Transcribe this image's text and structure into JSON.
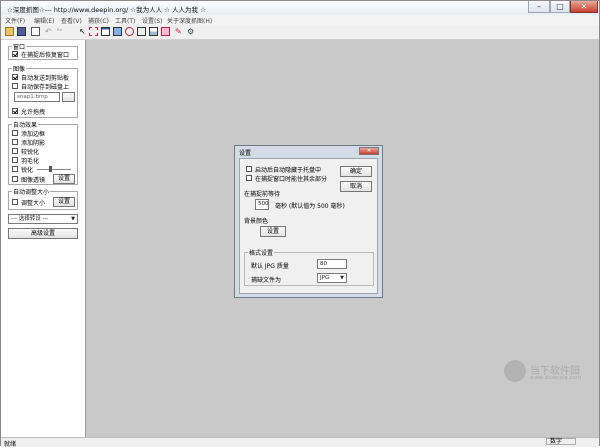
{
  "app": {
    "title": "☆深度抓图☆--- http://www.deepin.org/    ☆我为人人 ☆ 人人为我 ☆",
    "window_controls": {
      "minimize": "–",
      "maximize": "□",
      "close": "✕"
    }
  },
  "menu": [
    "文件(F)",
    "编辑(E)",
    "查看(V)",
    "捕获(C)",
    "工具(T)",
    "设置(S)",
    "关于深度抓图(H)"
  ],
  "toolbar_icons": [
    "open-icon",
    "save-icon",
    "copy-icon",
    "undo-icon",
    "redo-icon",
    "capture-cursor-icon",
    "capture-region-icon",
    "capture-window-icon",
    "capture-fullscreen-icon",
    "capture-object-icon",
    "capture-scroll-icon",
    "capture-menu-icon",
    "capture-fixed-icon",
    "capture-hand-icon",
    "settings-icon"
  ],
  "sidebar": {
    "window_group": {
      "title": "窗口",
      "restore_label": "在捕捉后恢复窗口"
    },
    "image_group": {
      "title": "图像",
      "auto_clipboard": "自动发送到剪贴板",
      "auto_save": "自动保存到磁盘上",
      "filename": "snap1.bmp",
      "allow_drag": "允许拖拽"
    },
    "effects_group": {
      "title": "自动效果",
      "items": [
        "添加边框",
        "添加阴影",
        "较锐化",
        "羽毛化",
        "锐化"
      ],
      "transparency_label": "图像透镜",
      "transparency_button": "设置"
    },
    "resize_group": {
      "title": "自动调整大小",
      "resize_label": "调整大小",
      "resize_button": "设置"
    },
    "format_select": "--- 选择转设 ---",
    "advanced_button": "高级设置"
  },
  "dialog": {
    "title": "设置",
    "close": "✕",
    "hide_tray": "启动后自动隐藏于托盘中",
    "hide_rest": "在捕捉窗口时能住其余部分",
    "wait_label": "在捕捉前等待",
    "wait_value": "500",
    "wait_unit": "毫秒 (默认值为 500 毫秒)",
    "bg_label": "背景颜色",
    "bg_button": "设置",
    "ok_button": "确定",
    "cancel_button": "取消",
    "format_group": "格式设置",
    "jpg_quality_label": "默认 JPG 质量",
    "jpg_quality_value": "80",
    "default_type_label": "捕缺文件为",
    "default_type_value": "JPG"
  },
  "status": {
    "left": "就绪",
    "right": "数字"
  },
  "watermark": {
    "text": "当下软件园",
    "url": "www.downxia.com"
  },
  "colors": {
    "canvas": "#c9c9c9",
    "close_button": "#c8412f"
  }
}
